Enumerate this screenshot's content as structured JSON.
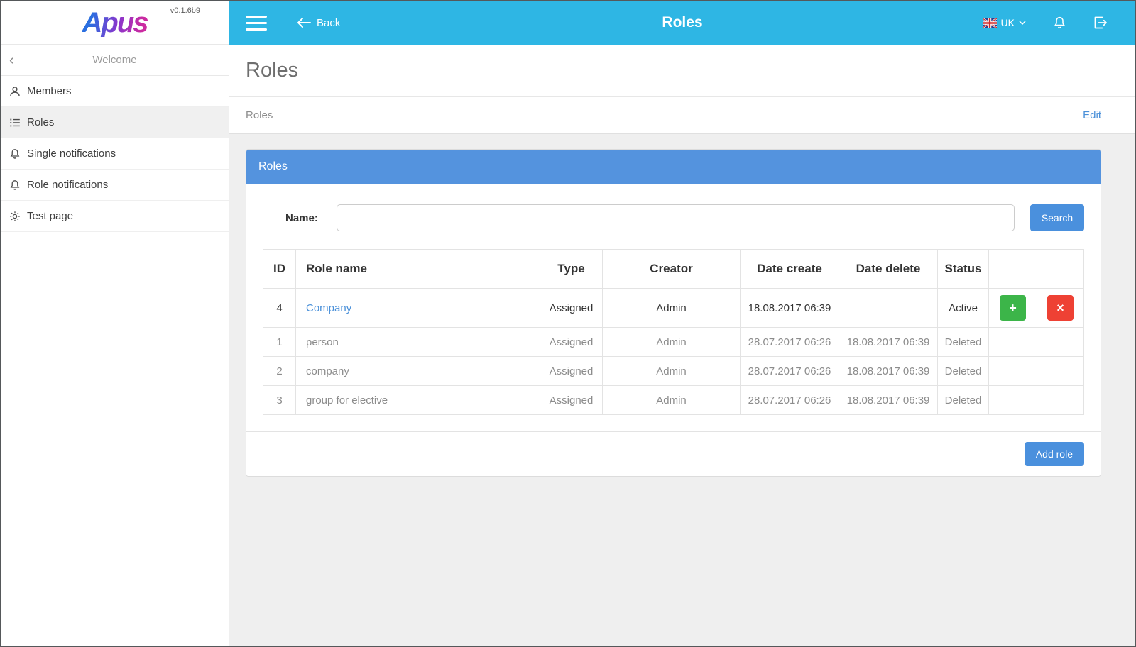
{
  "app": {
    "logo_text": "Apus",
    "version": "v0.1.6b9"
  },
  "sidebar": {
    "welcome_label": "Welcome",
    "collapse_glyph": "‹",
    "items": [
      {
        "label": "Members",
        "icon": "person-icon",
        "active": false
      },
      {
        "label": "Roles",
        "icon": "list-icon",
        "active": true
      },
      {
        "label": "Single notifications",
        "icon": "bell-icon",
        "active": false
      },
      {
        "label": "Role notifications",
        "icon": "bell-icon",
        "active": false
      },
      {
        "label": "Test page",
        "icon": "gear-icon",
        "active": false
      }
    ]
  },
  "topbar": {
    "back_label": "Back",
    "title": "Roles",
    "language": "UK",
    "icons": [
      "menu-icon",
      "back-arrow-icon",
      "uk-flag-icon",
      "chevron-down-icon",
      "bell-icon",
      "logout-icon"
    ]
  },
  "page": {
    "title": "Roles",
    "breadcrumb": "Roles",
    "edit_label": "Edit"
  },
  "panel": {
    "title": "Roles",
    "name_label": "Name:",
    "name_value": "",
    "search_label": "Search",
    "add_role_label": "Add role"
  },
  "table": {
    "headers": [
      "ID",
      "Role name",
      "Type",
      "Creator",
      "Date create",
      "Date delete",
      "Status",
      "",
      ""
    ],
    "actions": {
      "add_label": "+",
      "remove_label": "×"
    },
    "rows": [
      {
        "id": "4",
        "name": "Company",
        "type": "Assigned",
        "creator": "Admin",
        "date_create": "18.08.2017 06:39",
        "date_delete": "",
        "status": "Active"
      },
      {
        "id": "1",
        "name": "person",
        "type": "Assigned",
        "creator": "Admin",
        "date_create": "28.07.2017 06:26",
        "date_delete": "18.08.2017 06:39",
        "status": "Deleted"
      },
      {
        "id": "2",
        "name": "company",
        "type": "Assigned",
        "creator": "Admin",
        "date_create": "28.07.2017 06:26",
        "date_delete": "18.08.2017 06:39",
        "status": "Deleted"
      },
      {
        "id": "3",
        "name": "group for elective",
        "type": "Assigned",
        "creator": "Admin",
        "date_create": "28.07.2017 06:26",
        "date_delete": "18.08.2017 06:39",
        "status": "Deleted"
      }
    ]
  },
  "colors": {
    "topbar": "#2eb6e4",
    "panel_header": "#5493de",
    "button_blue": "#4a90dd",
    "button_green": "#3cb549",
    "button_red": "#ee4134",
    "link": "#4a90d9",
    "content_bg": "#efefef"
  }
}
